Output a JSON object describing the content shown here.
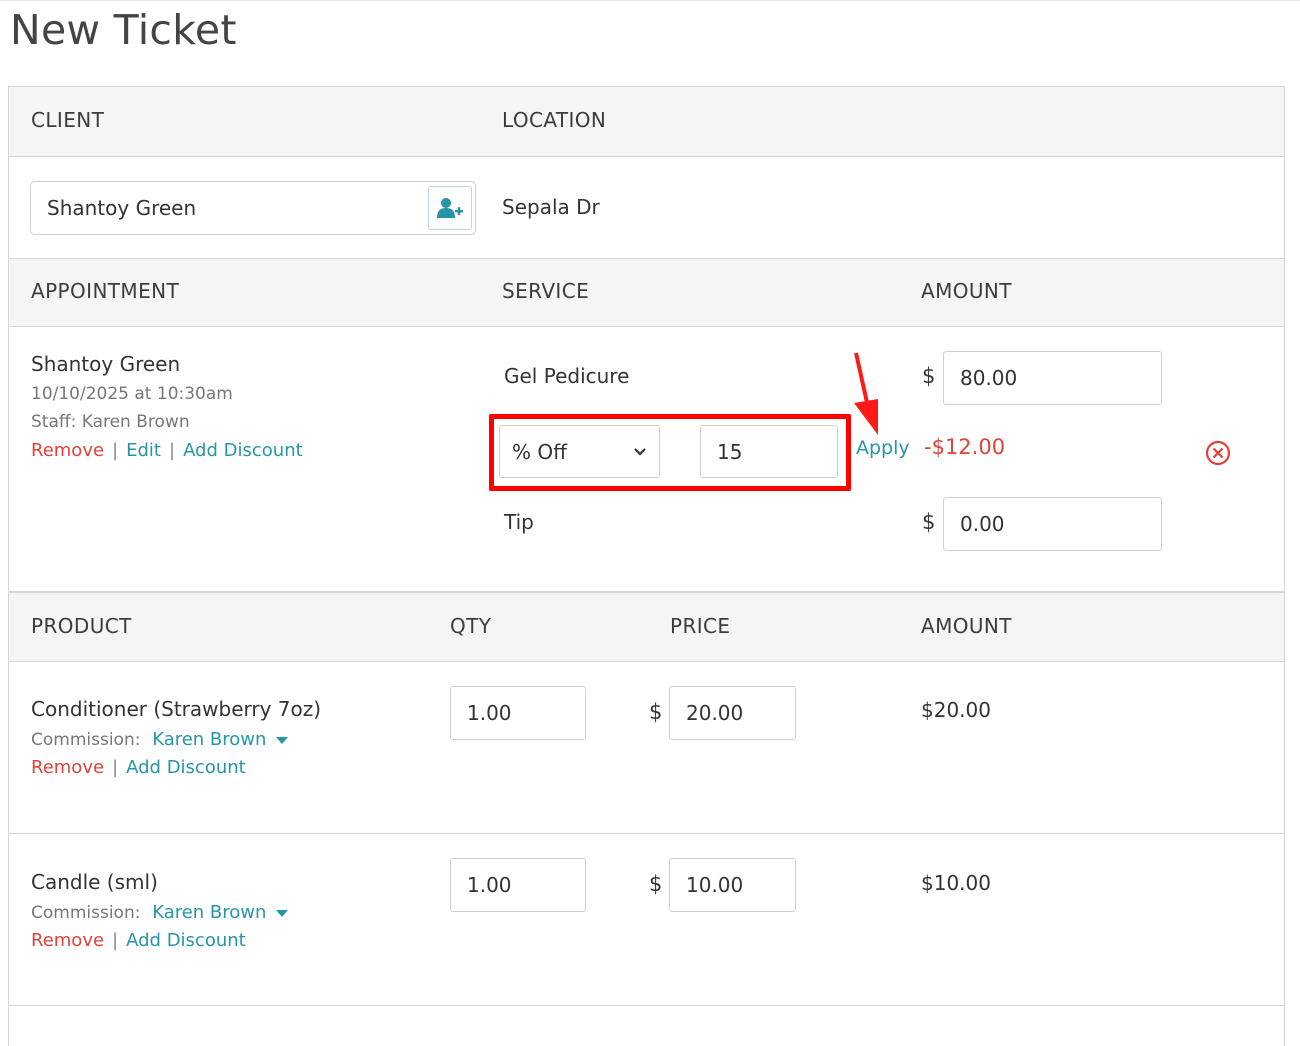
{
  "page": {
    "title": "New Ticket"
  },
  "client_section": {
    "client_header": "CLIENT",
    "location_header": "LOCATION",
    "client_value": "Shantoy Green",
    "location_value": "Sepala Dr"
  },
  "appointment_section": {
    "headers": {
      "appointment": "APPOINTMENT",
      "service": "SERVICE",
      "amount": "AMOUNT"
    },
    "client_name": "Shantoy Green",
    "datetime": "10/10/2025 at 10:30am",
    "staff": "Staff: Karen Brown",
    "actions": {
      "remove": "Remove",
      "edit": "Edit",
      "add_discount": "Add Discount",
      "separator": "|"
    },
    "service_name": "Gel Pedicure",
    "currency_symbol": "$",
    "service_amount": "80.00",
    "discount": {
      "type_selected": "% Off",
      "value": "15",
      "apply_label": "Apply",
      "result": "-$12.00"
    },
    "tip_label": "Tip",
    "tip_amount": "0.00"
  },
  "products_section": {
    "headers": {
      "product": "PRODUCT",
      "qty": "QTY",
      "price": "PRICE",
      "amount": "AMOUNT"
    },
    "commission_label": "Commission:",
    "items": [
      {
        "name": "Conditioner (Strawberry 7oz)",
        "commission_staff": "Karen Brown",
        "qty": "1.00",
        "price": "20.00",
        "amount": "$20.00",
        "remove": "Remove",
        "add_discount": "Add Discount"
      },
      {
        "name": "Candle (sml)",
        "commission_staff": "Karen Brown",
        "qty": "1.00",
        "price": "10.00",
        "amount": "$10.00",
        "remove": "Remove",
        "add_discount": "Add Discount"
      }
    ]
  },
  "colors": {
    "accent": "#2596a8",
    "danger": "#e0423a",
    "annotation": "#ff0000",
    "header_bg": "#f5f5f5"
  }
}
